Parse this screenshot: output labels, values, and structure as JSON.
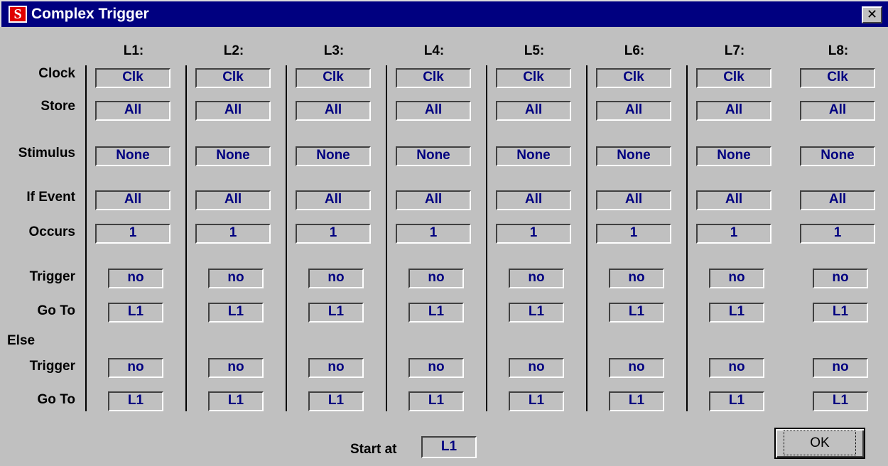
{
  "window": {
    "title": "Complex Trigger",
    "close_glyph": "✕",
    "icon": "app-s-logo-icon"
  },
  "row_labels": {
    "clock": "Clock",
    "store": "Store",
    "stimulus": "Stimulus",
    "if_event": "If Event",
    "occurs": "Occurs",
    "trigger": "Trigger",
    "goto": "Go To",
    "else": "Else",
    "else_trigger": "Trigger",
    "else_goto": "Go To"
  },
  "levels": [
    {
      "header": "L1:",
      "clock": "Clk",
      "store": "All",
      "stimulus": "None",
      "if_event": "All",
      "occurs": "1",
      "trigger": "no",
      "goto": "L1",
      "else_trigger": "no",
      "else_goto": "L1"
    },
    {
      "header": "L2:",
      "clock": "Clk",
      "store": "All",
      "stimulus": "None",
      "if_event": "All",
      "occurs": "1",
      "trigger": "no",
      "goto": "L1",
      "else_trigger": "no",
      "else_goto": "L1"
    },
    {
      "header": "L3:",
      "clock": "Clk",
      "store": "All",
      "stimulus": "None",
      "if_event": "All",
      "occurs": "1",
      "trigger": "no",
      "goto": "L1",
      "else_trigger": "no",
      "else_goto": "L1"
    },
    {
      "header": "L4:",
      "clock": "Clk",
      "store": "All",
      "stimulus": "None",
      "if_event": "All",
      "occurs": "1",
      "trigger": "no",
      "goto": "L1",
      "else_trigger": "no",
      "else_goto": "L1"
    },
    {
      "header": "L5:",
      "clock": "Clk",
      "store": "All",
      "stimulus": "None",
      "if_event": "All",
      "occurs": "1",
      "trigger": "no",
      "goto": "L1",
      "else_trigger": "no",
      "else_goto": "L1"
    },
    {
      "header": "L6:",
      "clock": "Clk",
      "store": "All",
      "stimulus": "None",
      "if_event": "All",
      "occurs": "1",
      "trigger": "no",
      "goto": "L1",
      "else_trigger": "no",
      "else_goto": "L1"
    },
    {
      "header": "L7:",
      "clock": "Clk",
      "store": "All",
      "stimulus": "None",
      "if_event": "All",
      "occurs": "1",
      "trigger": "no",
      "goto": "L1",
      "else_trigger": "no",
      "else_goto": "L1"
    },
    {
      "header": "L8:",
      "clock": "Clk",
      "store": "All",
      "stimulus": "None",
      "if_event": "All",
      "occurs": "1",
      "trigger": "no",
      "goto": "L1",
      "else_trigger": "no",
      "else_goto": "L1"
    }
  ],
  "start_at": {
    "label": "Start at",
    "value": "L1"
  },
  "buttons": {
    "ok": "OK"
  },
  "colors": {
    "title_bar": "#000080",
    "field_text": "#000080",
    "dialog_bg": "#c0c0c0",
    "icon_red": "#e00000"
  }
}
